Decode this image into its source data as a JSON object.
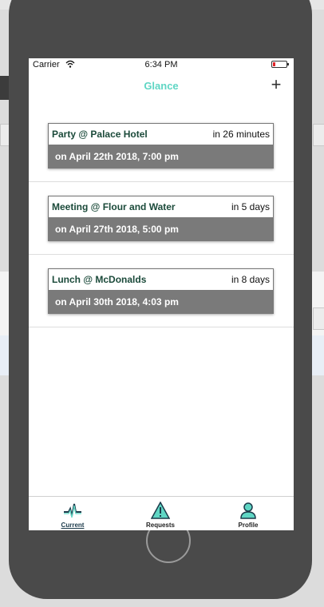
{
  "status_bar": {
    "carrier": "Carrier",
    "time": "6:34 PM",
    "battery_color": "#e0262a"
  },
  "nav": {
    "title": "Glance",
    "add_label": "+",
    "accent": "#5fd6c4"
  },
  "events": [
    {
      "title": "Party @ Palace Hotel",
      "eta": "in 26 minutes",
      "date": "on April 22th 2018, 7:00 pm"
    },
    {
      "title": "Meeting @ Flour and Water",
      "eta": "in 5 days",
      "date": "on April 27th 2018, 5:00 pm"
    },
    {
      "title": "Lunch @ McDonalds",
      "eta": "in 8 days",
      "date": "on April 30th 2018, 4:03 pm"
    }
  ],
  "tab_bar": {
    "tabs": [
      {
        "label": "Current",
        "icon": "heartbeat-icon",
        "active": true
      },
      {
        "label": "Requests",
        "icon": "warning-icon",
        "active": false
      },
      {
        "label": "Profile",
        "icon": "person-icon",
        "active": false
      }
    ]
  }
}
